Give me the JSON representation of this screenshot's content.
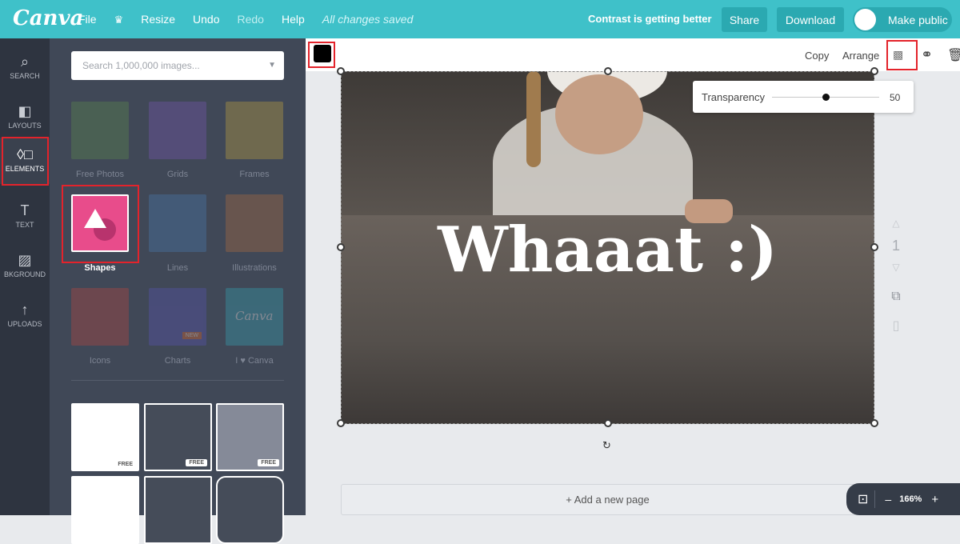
{
  "topbar": {
    "logo": "Canva",
    "menu": {
      "file": "File",
      "resize": "Resize",
      "undo": "Undo",
      "redo": "Redo",
      "help": "Help",
      "saved_status": "All changes saved"
    },
    "contrast_text": "Contrast is getting better",
    "share_label": "Share",
    "download_label": "Download",
    "make_public_label": "Make public"
  },
  "rail": [
    {
      "label": "SEARCH",
      "icon": "search-icon"
    },
    {
      "label": "LAYOUTS",
      "icon": "layouts-icon"
    },
    {
      "label": "ELEMENTS",
      "icon": "elements-icon"
    },
    {
      "label": "TEXT",
      "icon": "text-icon"
    },
    {
      "label": "BKGROUND",
      "icon": "background-icon"
    },
    {
      "label": "UPLOADS",
      "icon": "uploads-icon"
    }
  ],
  "panel": {
    "search_placeholder": "Search 1,000,000 images...",
    "tiles": [
      {
        "label": "Free Photos"
      },
      {
        "label": "Grids"
      },
      {
        "label": "Frames"
      },
      {
        "label": "Shapes"
      },
      {
        "label": "Lines"
      },
      {
        "label": "Illustrations"
      },
      {
        "label": "Icons"
      },
      {
        "label": "Charts"
      },
      {
        "label": "I ♥ Canva"
      }
    ],
    "new_badge": "NEW",
    "free_badge": "FREE",
    "canva_tile_text": "Canva"
  },
  "toolbar": {
    "copy_label": "Copy",
    "arrange_label": "Arrange"
  },
  "transparency": {
    "label": "Transparency",
    "value": "50",
    "level": 0.5
  },
  "canvas": {
    "headline": "Whaaat :)",
    "page_number": "1"
  },
  "add_page_label": "+ Add a new page",
  "zoom": {
    "minus": "–",
    "value": "166%",
    "plus": "+"
  },
  "colors": {
    "accent": "#3fc1c9",
    "button": "#2ba9b1",
    "shapes_tile": "#e84c8b",
    "highlight": "#e3232b"
  }
}
